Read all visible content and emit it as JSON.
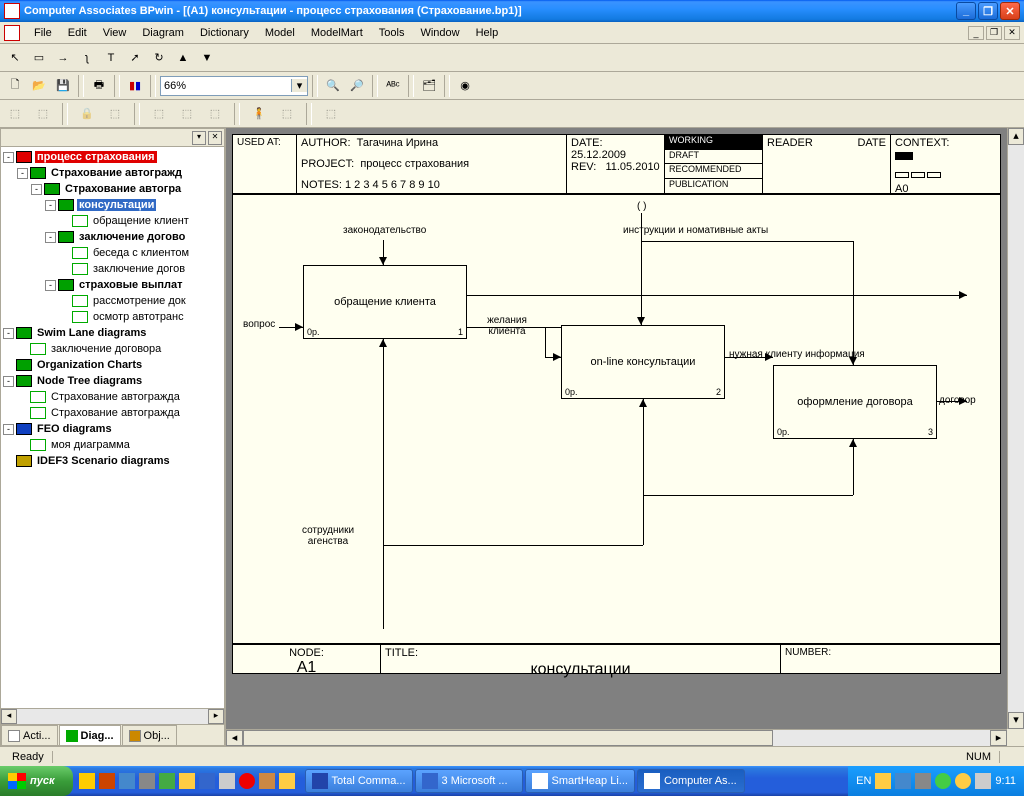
{
  "window": {
    "title": "Computer Associates BPwin - [(A1) консультации  - процесс страхования  (Страхование.bp1)]"
  },
  "menu": [
    "File",
    "Edit",
    "View",
    "Diagram",
    "Dictionary",
    "Model",
    "ModelMart",
    "Tools",
    "Window",
    "Help"
  ],
  "zoom": "66%",
  "tree": {
    "root": "процесс страхования",
    "items": [
      {
        "ind": 1,
        "exp": "-",
        "icon": "green",
        "bold": true,
        "label": "Страхование автогражд"
      },
      {
        "ind": 2,
        "exp": "-",
        "icon": "green",
        "bold": true,
        "label": "Страхование автогра"
      },
      {
        "ind": 3,
        "exp": "-",
        "icon": "green",
        "sel": true,
        "bold": true,
        "label": "консультации"
      },
      {
        "ind": 4,
        "exp": "",
        "icon": "text",
        "label": "обращение клиент"
      },
      {
        "ind": 3,
        "exp": "-",
        "icon": "green",
        "bold": true,
        "label": "заключение догово"
      },
      {
        "ind": 4,
        "exp": "",
        "icon": "text",
        "label": "беседа с клиентом"
      },
      {
        "ind": 4,
        "exp": "",
        "icon": "text",
        "label": "заключение догов"
      },
      {
        "ind": 3,
        "exp": "-",
        "icon": "green",
        "bold": true,
        "label": "страховые выплат"
      },
      {
        "ind": 4,
        "exp": "",
        "icon": "text",
        "label": "рассмотрение док"
      },
      {
        "ind": 4,
        "exp": "",
        "icon": "text",
        "label": "осмотр автотранс"
      },
      {
        "ind": 0,
        "exp": "-",
        "icon": "green",
        "bold": true,
        "label": "Swim Lane diagrams"
      },
      {
        "ind": 1,
        "exp": "",
        "icon": "text",
        "label": "заключение договора"
      },
      {
        "ind": 0,
        "exp": "",
        "icon": "green",
        "bold": true,
        "label": "Organization Charts"
      },
      {
        "ind": 0,
        "exp": "-",
        "icon": "green",
        "bold": true,
        "label": "Node Tree diagrams"
      },
      {
        "ind": 1,
        "exp": "",
        "icon": "text",
        "label": "Страхование автогражда"
      },
      {
        "ind": 1,
        "exp": "",
        "icon": "text",
        "label": "Страхование автогражда"
      },
      {
        "ind": 0,
        "exp": "-",
        "icon": "feo",
        "bold": true,
        "label": "FEO diagrams"
      },
      {
        "ind": 1,
        "exp": "",
        "icon": "text",
        "label": "моя диаграмма"
      },
      {
        "ind": 0,
        "exp": "",
        "icon": "idef",
        "bold": true,
        "label": "IDEF3 Scenario diagrams"
      }
    ]
  },
  "tabs": [
    {
      "icon": "text",
      "label": "Acti..."
    },
    {
      "icon": "green",
      "label": "Diag...",
      "active": true
    },
    {
      "icon": "text",
      "label": "Obj..."
    }
  ],
  "header": {
    "usedat": "USED AT:",
    "author_lbl": "AUTHOR:",
    "author": "Тагачина Ирина",
    "project_lbl": "PROJECT:",
    "project": "процесс страхования",
    "notes": "NOTES: 1 2 3 4 5 6 7 8 9 10",
    "date_lbl": "DATE:",
    "date": "25.12.2009",
    "rev_lbl": "REV:",
    "rev": "11.05.2010",
    "statuses": [
      "WORKING",
      "DRAFT",
      "RECOMMENDED",
      "PUBLICATION"
    ],
    "reader": "READER",
    "date2": "DATE",
    "context": "CONTEXT:",
    "context_val": "A0"
  },
  "boxes": {
    "b1": {
      "title": "обращение клиента",
      "num": "1",
      "lp": "0р."
    },
    "b2": {
      "title": "on-line консультации",
      "num": "2",
      "lp": "0р."
    },
    "b3": {
      "title": "оформление договора",
      "num": "3",
      "lp": "0р."
    }
  },
  "labels": {
    "zakon": "законодательство",
    "instr": "инструкции и номативные акты",
    "vopros": "вопрос",
    "zhel": "желания клиента",
    "nuzh": "нужная клиенту информация",
    "dogov": "договор",
    "sotr": "сотрудники агенства",
    "tunnel": "( )"
  },
  "footer": {
    "node_lbl": "NODE:",
    "node": "A1",
    "title_lbl": "TITLE:",
    "title": "консультации",
    "number_lbl": "NUMBER:"
  },
  "status": {
    "ready": "Ready",
    "num": "NUM"
  },
  "taskbar": {
    "start": "пуск",
    "items": [
      {
        "label": "Total Comma..."
      },
      {
        "label": "3 Microsoft ..."
      },
      {
        "label": "SmartHeap Li..."
      },
      {
        "label": "Computer As...",
        "active": true
      }
    ],
    "lang": "EN",
    "time": "9:11"
  }
}
